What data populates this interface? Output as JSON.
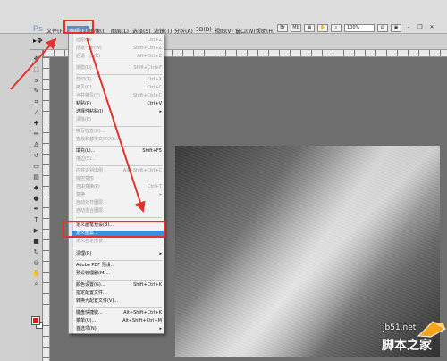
{
  "menubar": {
    "logo": "Ps",
    "items": [
      {
        "label": "文件(F)"
      },
      {
        "label": "编辑(E)"
      },
      {
        "label": "图像(I)"
      },
      {
        "label": "图层(L)"
      },
      {
        "label": "选择(S)"
      },
      {
        "label": "滤镜(T)"
      },
      {
        "label": "分析(A)"
      },
      {
        "label": "3D(D)"
      },
      {
        "label": "视图(V)"
      },
      {
        "label": "窗口(W)"
      },
      {
        "label": "帮助(H)"
      }
    ],
    "zoom": "100%"
  },
  "edit_menu": {
    "items": [
      {
        "label": "还原(O)",
        "shortcut": "Ctrl+Z",
        "disabled": true
      },
      {
        "label": "前进一步(W)",
        "shortcut": "Shift+Ctrl+Z",
        "disabled": true
      },
      {
        "label": "后退一步(K)",
        "shortcut": "Alt+Ctrl+Z",
        "disabled": true
      },
      {
        "label": "渐隐(D)...",
        "shortcut": "Shift+Ctrl+F",
        "disabled": true
      },
      {
        "label": "剪切(T)",
        "shortcut": "Ctrl+X",
        "disabled": true
      },
      {
        "label": "拷贝(C)",
        "shortcut": "Ctrl+C",
        "disabled": true
      },
      {
        "label": "合并拷贝(Y)",
        "shortcut": "Shift+Ctrl+C",
        "disabled": true
      },
      {
        "label": "粘贴(P)",
        "shortcut": "Ctrl+V",
        "disabled": false
      },
      {
        "label": "选择性粘贴(I)",
        "shortcut": "",
        "disabled": false,
        "submenu": true
      },
      {
        "label": "清除(E)",
        "shortcut": "",
        "disabled": true
      },
      {
        "label": "拼写检查(H)...",
        "shortcut": "",
        "disabled": true
      },
      {
        "label": "查找和替换文本(X)...",
        "shortcut": "",
        "disabled": true
      },
      {
        "label": "填充(L)...",
        "shortcut": "Shift+F5",
        "disabled": false
      },
      {
        "label": "描边(S)...",
        "shortcut": "",
        "disabled": true
      },
      {
        "label": "内容识别比例",
        "shortcut": "Alt+Shift+Ctrl+C",
        "disabled": true
      },
      {
        "label": "操控变形",
        "shortcut": "",
        "disabled": true
      },
      {
        "label": "自由变换(F)",
        "shortcut": "Ctrl+T",
        "disabled": true
      },
      {
        "label": "变换",
        "shortcut": "",
        "disabled": true,
        "submenu": true
      },
      {
        "label": "自动对齐图层...",
        "shortcut": "",
        "disabled": true
      },
      {
        "label": "自动混合图层...",
        "shortcut": "",
        "disabled": true
      },
      {
        "label": "定义画笔预设(B)...",
        "shortcut": "",
        "disabled": false
      },
      {
        "label": "定义图案...",
        "shortcut": "",
        "disabled": false,
        "highlighted": true
      },
      {
        "label": "定义自定形状...",
        "shortcut": "",
        "disabled": true
      },
      {
        "label": "清理(R)",
        "shortcut": "",
        "disabled": false,
        "submenu": true
      },
      {
        "label": "Adobe PDF 预设...",
        "shortcut": "",
        "disabled": false
      },
      {
        "label": "预设管理器(M)...",
        "shortcut": "",
        "disabled": false
      },
      {
        "label": "颜色设置(G)...",
        "shortcut": "Shift+Ctrl+K",
        "disabled": false
      },
      {
        "label": "指定配置文件...",
        "shortcut": "",
        "disabled": false
      },
      {
        "label": "转换为配置文件(V)...",
        "shortcut": "",
        "disabled": false
      },
      {
        "label": "键盘快捷键...",
        "shortcut": "Alt+Shift+Ctrl+K",
        "disabled": false
      },
      {
        "label": "菜单(U)...",
        "shortcut": "Alt+Shift+Ctrl+M",
        "disabled": false
      },
      {
        "label": "首选项(N)",
        "shortcut": "",
        "disabled": false,
        "submenu": true
      }
    ]
  },
  "watermark": {
    "url": "jb51.net",
    "site_name": "脚本之家"
  },
  "colors": {
    "highlight": "#3b8fd9",
    "annotation_red": "#e2332f",
    "foreground_swatch": "#d71c1c"
  }
}
